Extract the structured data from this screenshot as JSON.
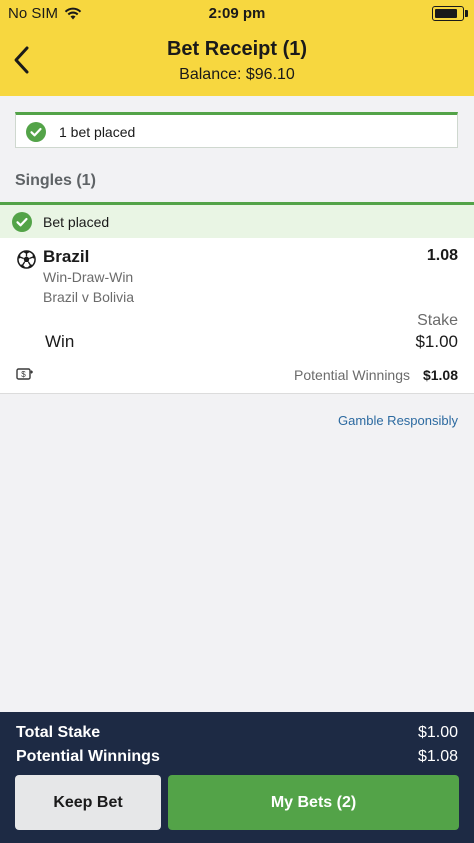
{
  "status_bar": {
    "carrier": "No SIM",
    "time": "2:09 pm",
    "battery_level": 0.85
  },
  "header": {
    "title": "Bet Receipt (1)",
    "balance": "Balance: $96.10"
  },
  "banner": {
    "text": "1 bet placed"
  },
  "singles": {
    "title": "Singles (1)"
  },
  "bet": {
    "status": "Bet placed",
    "selection": "Brazil",
    "odds": "1.08",
    "market": "Win-Draw-Win",
    "event": "Brazil v Bolivia",
    "stake_label": "Stake",
    "stake": "$1.00",
    "type": "Win",
    "potential_label": "Potential Winnings",
    "potential": "$1.08"
  },
  "gamble_link": "Gamble Responsibly",
  "footer": {
    "total_stake_label": "Total Stake",
    "total_stake": "$1.00",
    "potential_label": "Potential Winnings",
    "potential": "$1.08",
    "keep_bet": "Keep Bet",
    "my_bets": "My Bets (2)"
  },
  "colors": {
    "header_bg": "#f7d73f",
    "success": "#53a348",
    "footer_bg": "#1d2a44",
    "link": "#2c6aa0"
  },
  "icons": [
    "wifi-icon",
    "battery-icon",
    "back-arrow-icon",
    "check-circle-icon",
    "soccer-ball-icon",
    "cash-out-icon"
  ]
}
